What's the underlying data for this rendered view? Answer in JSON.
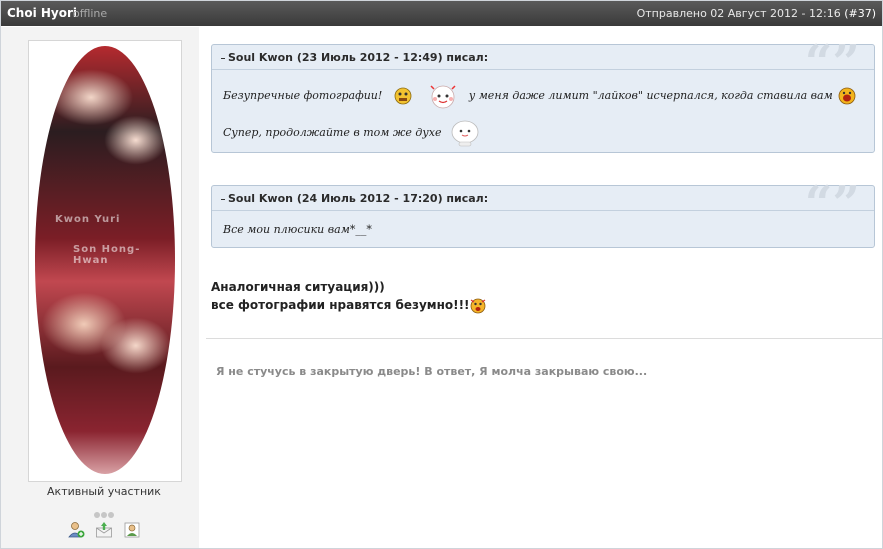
{
  "post": {
    "author": "Choi Hyori",
    "status": "offline",
    "sent_prefix": "Отправлено 02 Август 2012 - 12:16",
    "post_number": "(#37)"
  },
  "profile": {
    "avatar_text_1": "Kwon Yuri",
    "avatar_text_2": "Son Hong-Hwan",
    "rank": "Активный участник",
    "rank_pips": 3,
    "actions": [
      "add-friend-icon",
      "send-message-icon",
      "view-profile-icon"
    ]
  },
  "quotes": [
    {
      "header": "Soul Kwon (23 Июль 2012 - 12:49) писал:",
      "line1_a": "Безупречные фотографии!",
      "line1_b": "у меня даже лимит \"лайков\" исчерпался, когда ставила вам",
      "line2": "Супер, продолжайте в том же духе"
    },
    {
      "header": "Soul Kwon (24 Июль 2012 - 17:20) писал:",
      "line1": "Все мои плюсики вам*__*"
    }
  ],
  "reply": {
    "line1": "Аналогичная ситуация)))",
    "line2": "все фотографии нравятся безумно!!!"
  },
  "signature": "Я не стучусь в закрытую дверь! В ответ, Я молча закрываю свою..."
}
